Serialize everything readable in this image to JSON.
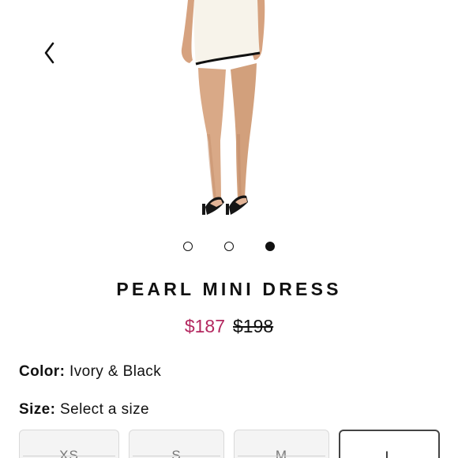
{
  "product": {
    "title": "PEARL MINI DRESS",
    "sale_price": "$187",
    "original_price": "$198",
    "color_label": "Color:",
    "color_value": "Ivory & Black",
    "size_label": "Size:",
    "size_value": "Select a size"
  },
  "gallery": {
    "slide_count": 3,
    "active_index": 2
  },
  "sizes": [
    {
      "label": "XS",
      "available": false
    },
    {
      "label": "S",
      "available": false
    },
    {
      "label": "M",
      "available": false
    },
    {
      "label": "L",
      "available": true
    }
  ],
  "icons": {
    "back": "chevron-left-icon"
  },
  "colors": {
    "sale_price": "#b3275f",
    "text": "#111111",
    "dress": "#f7f3ea",
    "dress_trim": "#111111",
    "skin": "#d9a987"
  }
}
